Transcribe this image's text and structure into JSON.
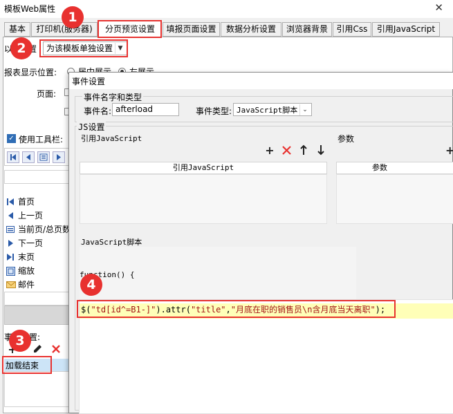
{
  "window": {
    "title": "模板Web属性",
    "close_glyph": "✕"
  },
  "tabs": [
    "基本",
    "打印机(服务器)",
    "分页预览设置",
    "填报页面设置",
    "数据分析设置",
    "浏览器背景",
    "引用Css",
    "引用JavaScript"
  ],
  "settings": {
    "mode_label": "以",
    "mode_label_tail": "置",
    "mode_value": "为该模板单独设置",
    "report_position_label": "报表显示位置:",
    "position_opt1": "居中展示",
    "position_opt2": "左展示",
    "page_label": "页面:",
    "use_toolbar_label": "使用工具栏:",
    "event_label": "事件设置:",
    "event_item": "加载结束"
  },
  "toolbar_items": [
    "首页",
    "上一页",
    "当前页/总页数",
    "下一页",
    "末页",
    "缩放",
    "邮件"
  ],
  "dialog": {
    "title": "事件设置",
    "event_group_title": "事件名字和类型",
    "event_name_label": "事件名:",
    "event_name_value": "afterload",
    "event_type_label": "事件类型:",
    "event_type_value": "JavaScript脚本",
    "js_group_title": "JS设置",
    "ref_js_label": "引用JavaScript",
    "params_label": "参数",
    "ref_js_column": "引用JavaScript",
    "params_column": "参数",
    "script_label": "JavaScript脚本",
    "code_line1": "function() {",
    "code_line2": "$(\"td[id^=B1-]\").attr(\"title\",\"月底在职的销售员\\n含月底当天离职\");"
  },
  "markers": [
    "1",
    "2",
    "3",
    "4"
  ],
  "colors": {
    "marker": "#e8312f",
    "selection": "#cce4f7",
    "code_highlight": "#ffffb8"
  }
}
